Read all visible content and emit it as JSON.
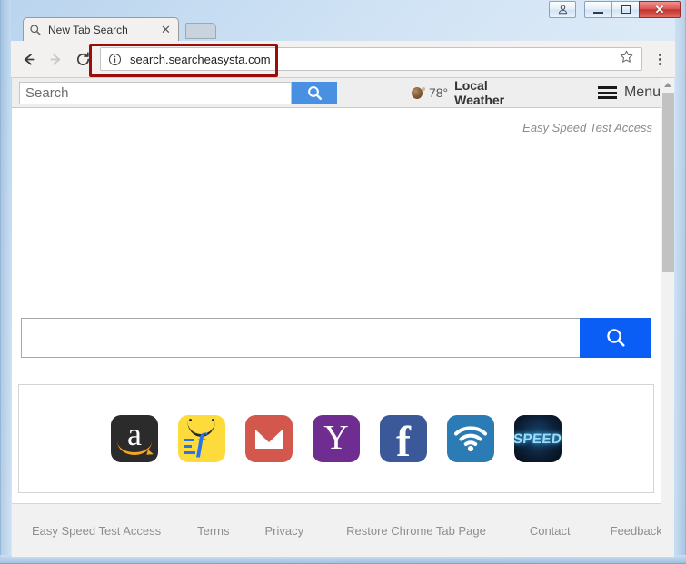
{
  "window": {
    "caption_buttons": {
      "user_icon": "user-account-icon",
      "minimize": "–",
      "maximize": "□",
      "close": "✕"
    }
  },
  "browser": {
    "tab": {
      "title": "New Tab Search",
      "favicon": "magnifier-icon",
      "close_label": "✕"
    },
    "new_tab_button_label": "",
    "toolbar": {
      "back_label": "←",
      "forward_label": "→",
      "reload_label": "⟳",
      "omnibox": {
        "security_icon": "info-circle-icon",
        "url": "search.searcheasysta.com",
        "bookmark_icon": "star-outline-icon"
      },
      "menu_icon": "three-dot-menu-icon"
    },
    "annotation": {
      "color": "#9e0b0b",
      "target": "address-bar"
    }
  },
  "site_header": {
    "search_placeholder": "Search",
    "search_value": "",
    "search_button_icon": "magnifier-icon",
    "search_button_color": "#4a90e2",
    "weather": {
      "icon": "weather-icon",
      "temperature": "78°",
      "label": "Local Weather"
    },
    "menu": {
      "icon": "hamburger-icon",
      "label": "Menu"
    }
  },
  "main": {
    "tagline": "Easy Speed Test Access",
    "search": {
      "placeholder": "",
      "value": "",
      "button_icon": "magnifier-icon",
      "button_color": "#0b5ef5"
    },
    "shortcuts": [
      {
        "name": "Amazon",
        "icon": "amazon-icon",
        "letter": "a",
        "color": "#2b2b2b"
      },
      {
        "name": "Flipkart",
        "icon": "flipkart-icon",
        "letter": "f",
        "color": "#fddb3a"
      },
      {
        "name": "Gmail",
        "icon": "gmail-icon",
        "letter": "",
        "color": "#d3574c"
      },
      {
        "name": "Yahoo",
        "icon": "yahoo-icon",
        "letter": "Y",
        "color": "#6f2d91"
      },
      {
        "name": "Facebook",
        "icon": "facebook-icon",
        "letter": "f",
        "color": "#3b5998"
      },
      {
        "name": "Speedtest",
        "icon": "wifi-icon",
        "letter": "",
        "color": "#2b7bb5"
      },
      {
        "name": "Speed",
        "icon": "speed-icon",
        "letter": "SPEED",
        "color": "#0d2139"
      }
    ]
  },
  "footer": {
    "links": [
      "Easy Speed Test Access",
      "Terms",
      "Privacy",
      "Restore Chrome Tab Page",
      "Contact",
      "Feedback"
    ]
  },
  "scrollbar": {
    "up_arrow": "scroll-up-arrow-icon",
    "position": "top"
  }
}
